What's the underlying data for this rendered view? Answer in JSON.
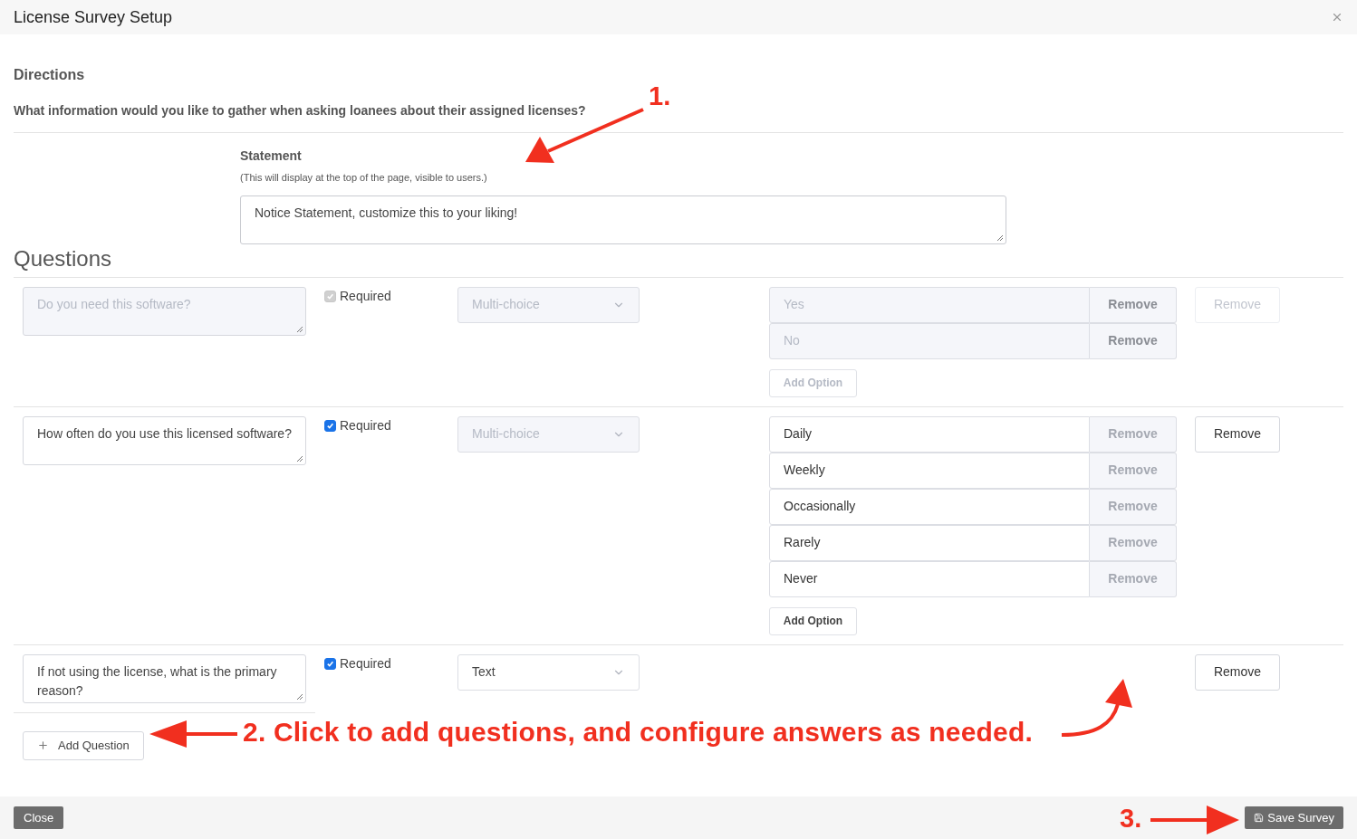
{
  "window": {
    "title": "License Survey Setup"
  },
  "directions": {
    "heading": "Directions",
    "prompt": "What information would you like to gather when asking loanees about their assigned licenses?"
  },
  "statement": {
    "label": "Statement",
    "hint": "(This will display at the top of the page, visible to users.)",
    "value": "Notice Statement, customize this to your liking!"
  },
  "questions_heading": "Questions",
  "questions": [
    {
      "text": "Do you need this software?",
      "disabled": true,
      "required": {
        "label": "Required",
        "checked": true,
        "disabled": true
      },
      "type": {
        "value": "Multi-choice",
        "disabled": true
      },
      "options_disabled": true,
      "options": [
        {
          "value": "Yes",
          "remove": "Remove"
        },
        {
          "value": "No",
          "remove": "Remove"
        }
      ],
      "add_option": {
        "label": "Add Option",
        "disabled": true
      },
      "remove": {
        "label": "Remove",
        "disabled": true
      }
    },
    {
      "text": "How often do you use this licensed software?",
      "disabled": false,
      "required": {
        "label": "Required",
        "checked": true,
        "disabled": false
      },
      "type": {
        "value": "Multi-choice",
        "disabled": true
      },
      "options_disabled": false,
      "options": [
        {
          "value": "Daily",
          "remove": "Remove"
        },
        {
          "value": "Weekly",
          "remove": "Remove"
        },
        {
          "value": "Occasionally",
          "remove": "Remove"
        },
        {
          "value": "Rarely",
          "remove": "Remove"
        },
        {
          "value": "Never",
          "remove": "Remove"
        }
      ],
      "add_option": {
        "label": "Add Option",
        "disabled": false
      },
      "remove": {
        "label": "Remove",
        "disabled": false
      }
    },
    {
      "text": "If not using the license, what is the primary reason?",
      "disabled": false,
      "required": {
        "label": "Required",
        "checked": true,
        "disabled": false
      },
      "type": {
        "value": "Text",
        "disabled": false
      },
      "remove": {
        "label": "Remove",
        "disabled": false
      }
    }
  ],
  "add_question": "Add Question",
  "footer": {
    "close": "Close",
    "save": "Save Survey"
  },
  "annotations": [
    {
      "kind": "step1",
      "label": "1."
    },
    {
      "kind": "step2",
      "label": "2. Click to add questions, and configure answers as needed."
    },
    {
      "kind": "step3",
      "label": "3."
    }
  ]
}
